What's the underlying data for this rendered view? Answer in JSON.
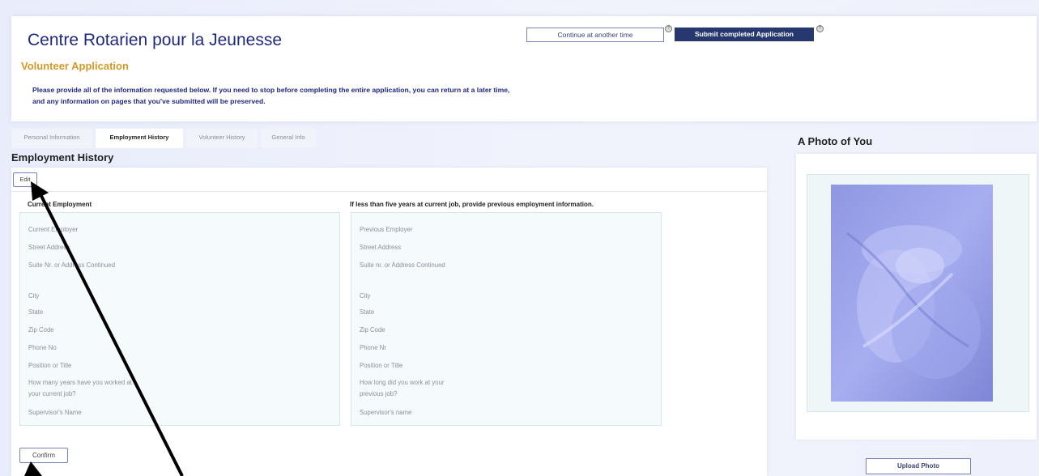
{
  "header": {
    "site_title": "Centre Rotarien pour la Jeunesse",
    "subtitle": "Volunteer Application",
    "instructions": "Please provide all of the information requested below. If you need to stop before completing the entire application, you can return at a later time, and any information on pages that you've submitted will be preserved.",
    "continue_label": "Continue at another time",
    "submit_label": "Submit completed Application"
  },
  "tabs": [
    {
      "label": "Personal Information",
      "active": false
    },
    {
      "label": "Employment History",
      "active": true
    },
    {
      "label": "Volunteer History",
      "active": false
    },
    {
      "label": "General Info",
      "active": false
    }
  ],
  "section_title": "Employment History",
  "edit_label": "Edit",
  "confirm_label": "Confirm",
  "current": {
    "heading": "Current Employment",
    "fields": [
      "Current Employer",
      "Street Address",
      "Suite Nr. or Address Continued",
      "City",
      "State",
      "Zip Code",
      "Phone No",
      "Position or Title",
      "How many years have you worked at your current job?",
      "Supervisor's Name"
    ]
  },
  "previous": {
    "heading": "If less than five years at current job, provide previous employment information.",
    "fields": [
      "Previous Employer",
      "Street Address",
      "Suite nr. or Address Continued",
      "City",
      "State",
      "Zip Code",
      "Phone Nr",
      "Position or Title",
      "How long did you work at your previous job?",
      "Supervisor's name"
    ]
  },
  "photo": {
    "title": "A Photo of You",
    "upload_label": "Upload Photo",
    "image_icon": "snow-angel-photo"
  },
  "colors": {
    "brand_navy": "#27386f",
    "accent_gold": "#d0992b",
    "title_blue": "#1f2a7a"
  }
}
